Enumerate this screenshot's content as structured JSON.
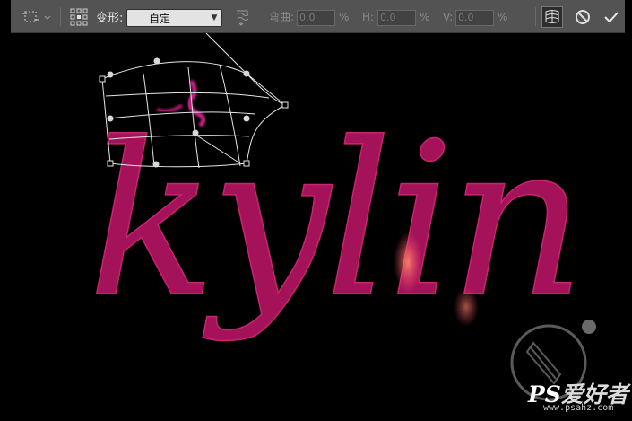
{
  "toolbar": {
    "warp_label": "变形:",
    "warp_value": "自定",
    "bend_label": "弯曲:",
    "bend_value": "0.0",
    "h_label": "H:",
    "h_value": "0.0",
    "v_label": "V:",
    "v_value": "0.0",
    "percent": "%"
  },
  "icons": {
    "transform_mode": "transform-mode-icon",
    "reference_point": "reference-point-icon",
    "change_orientation": "change-orientation-icon",
    "toggle_warp": "warp-toggle-icon",
    "cancel": "cancel-icon",
    "commit": "commit-icon"
  },
  "canvas": {
    "text": "kylin",
    "text_color": "#b0155f",
    "highlight_color": "#ff6a55"
  },
  "watermark": {
    "brand": "PS",
    "brand_cn": "爱好者",
    "url": "www.psahz.com"
  }
}
